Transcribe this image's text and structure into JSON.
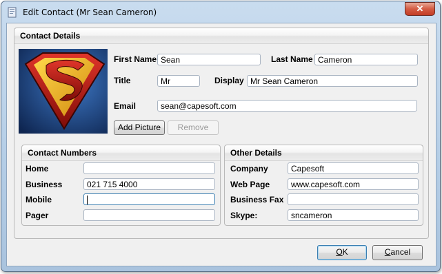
{
  "window": {
    "title": "Edit Contact  (Mr Sean Cameron)",
    "close_glyph": "✕"
  },
  "contact_details": {
    "header": "Contact Details",
    "first_name_label": "First Name",
    "first_name_value": "Sean",
    "last_name_label": "Last Name",
    "last_name_value": "Cameron",
    "title_label": "Title",
    "title_value": "Mr",
    "display_label": "Display",
    "display_value": "Mr Sean Cameron",
    "email_label": "Email",
    "email_value": "sean@capesoft.com",
    "add_picture_label": "Add Picture",
    "remove_label": "Remove"
  },
  "contact_numbers": {
    "header": "Contact Numbers",
    "home_label": "Home",
    "home_value": "",
    "business_label": "Business",
    "business_value": "021 715 4000",
    "mobile_label": "Mobile",
    "mobile_value": "",
    "pager_label": "Pager",
    "pager_value": ""
  },
  "other_details": {
    "header": "Other Details",
    "company_label": "Company",
    "company_value": "Capesoft",
    "webpage_label": "Web Page",
    "webpage_value": "www.capesoft.com",
    "business_fax_label": "Business Fax",
    "business_fax_value": "",
    "skype_label": "Skype:",
    "skype_value": "sncameron"
  },
  "footer": {
    "ok_label": "OK",
    "ok_accel": "O",
    "ok_rest": "K",
    "cancel_accel": "C",
    "cancel_rest": "ancel"
  },
  "colors": {
    "titlebar": "#b4cde6",
    "client": "#f0f0f0",
    "close_button": "#c23c25",
    "picture_bg": "#1b3e7a"
  },
  "icons": [
    "window-app-icon",
    "close-icon",
    "superman-logo-picture"
  ]
}
